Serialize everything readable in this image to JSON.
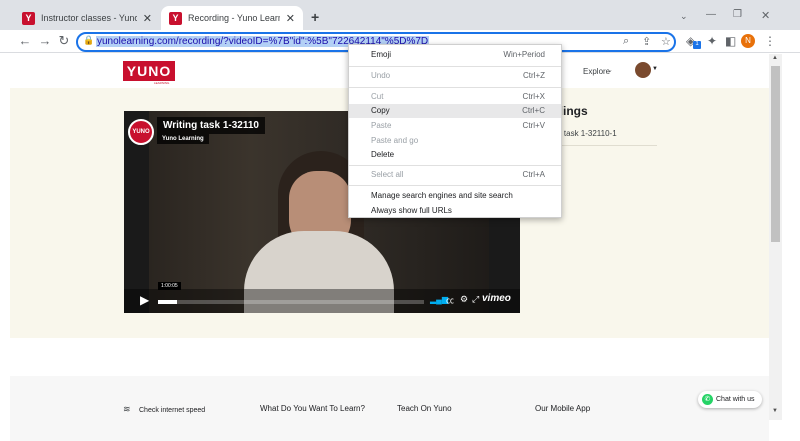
{
  "browser": {
    "tabs": [
      {
        "title": "Instructor classes - Yuno Learning",
        "favicon": "Y",
        "active": false
      },
      {
        "title": "Recording - Yuno Learning",
        "favicon": "Y",
        "active": true
      }
    ],
    "new_tab_label": "+",
    "url": "yunolearning.com/recording/?videoID=%7B\"id\":%5B\"722642114\"%5D%7D",
    "profile_initial": "N",
    "extension_badge": "1"
  },
  "site": {
    "logo_text": "YUNO",
    "logo_sub": "LEARNING",
    "nav_explore": "Explore",
    "page_heading_partial": "rdings",
    "recording_item_partial": "ing task 1-32110-1"
  },
  "video": {
    "title": "Writing task 1-32110",
    "channel": "Yuno Learning",
    "channel_short": "YUNO",
    "timestamp": "1:00:05",
    "progress": 0.07,
    "brand": "vimeo"
  },
  "context_menu": {
    "items": [
      {
        "label": "Emoji",
        "shortcut": "Win+Period",
        "enabled": true
      },
      {
        "label": "Undo",
        "shortcut": "Ctrl+Z",
        "enabled": false
      },
      {
        "label": "Cut",
        "shortcut": "Ctrl+X",
        "enabled": false
      },
      {
        "label": "Copy",
        "shortcut": "Ctrl+C",
        "enabled": true,
        "highlighted": true
      },
      {
        "label": "Paste",
        "shortcut": "Ctrl+V",
        "enabled": false
      },
      {
        "label": "Paste and go",
        "shortcut": "",
        "enabled": false
      },
      {
        "label": "Delete",
        "shortcut": "",
        "enabled": true
      },
      {
        "label": "Select all",
        "shortcut": "Ctrl+A",
        "enabled": false
      },
      {
        "label": "Manage search engines and site search",
        "shortcut": "",
        "enabled": true
      },
      {
        "label": "Always show full URLs",
        "shortcut": "",
        "enabled": true
      }
    ]
  },
  "footer": {
    "check_internet": "Check internet speed",
    "col1": "What Do You Want To Learn?",
    "col2": "Teach On Yuno",
    "col3": "Our Mobile App",
    "chat_label": "Chat with us"
  },
  "colors": {
    "brand_red": "#c8102e",
    "chrome_blue": "#1a73e8",
    "hero_bg": "#f9f7ec",
    "chat_green": "#25d366"
  }
}
